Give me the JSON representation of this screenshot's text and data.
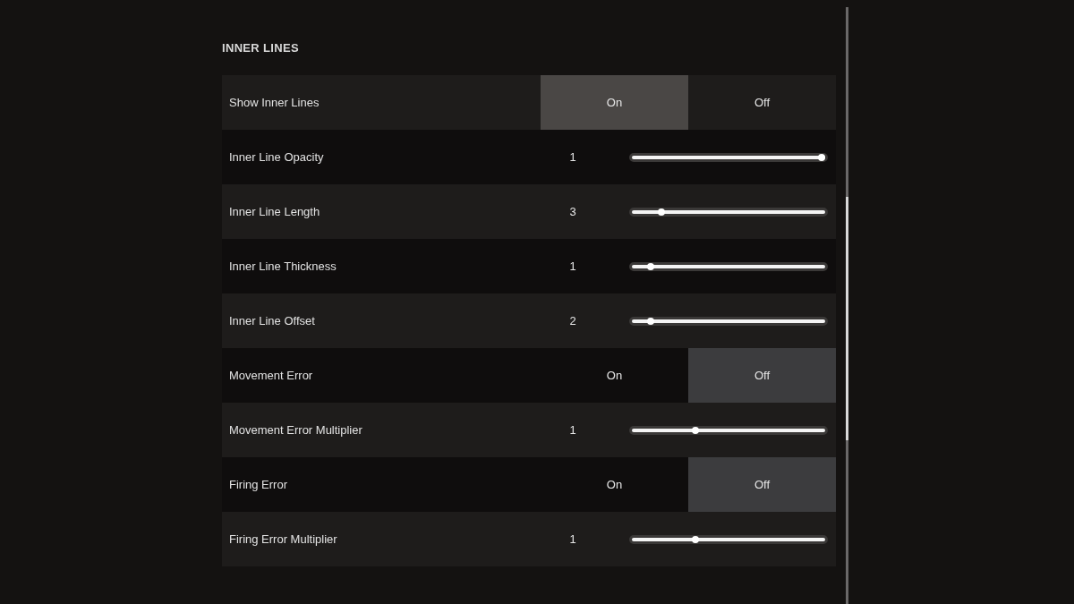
{
  "section": {
    "title": "INNER LINES"
  },
  "settings": [
    {
      "kind": "toggle",
      "label": "Show Inner Lines",
      "options": [
        {
          "label": "On",
          "selected": true
        },
        {
          "label": "Off",
          "selected": false
        }
      ]
    },
    {
      "kind": "slider",
      "label": "Inner Line Opacity",
      "value": "1",
      "level": 1.0
    },
    {
      "kind": "slider",
      "label": "Inner Line Length",
      "value": "3",
      "level": 0.14
    },
    {
      "kind": "slider",
      "label": "Inner Line Thickness",
      "value": "1",
      "level": 0.08
    },
    {
      "kind": "slider",
      "label": "Inner Line Offset",
      "value": "2",
      "level": 0.08
    },
    {
      "kind": "toggle",
      "label": "Movement Error",
      "options": [
        {
          "label": "On",
          "selected": false
        },
        {
          "label": "Off",
          "selected": true
        }
      ]
    },
    {
      "kind": "slider",
      "label": "Movement Error Multiplier",
      "value": "1",
      "level": 0.32
    },
    {
      "kind": "toggle",
      "label": "Firing Error",
      "options": [
        {
          "label": "On",
          "selected": false
        },
        {
          "label": "Off",
          "selected": true
        }
      ]
    },
    {
      "kind": "slider",
      "label": "Firing Error Multiplier",
      "value": "1",
      "level": 0.32
    }
  ]
}
